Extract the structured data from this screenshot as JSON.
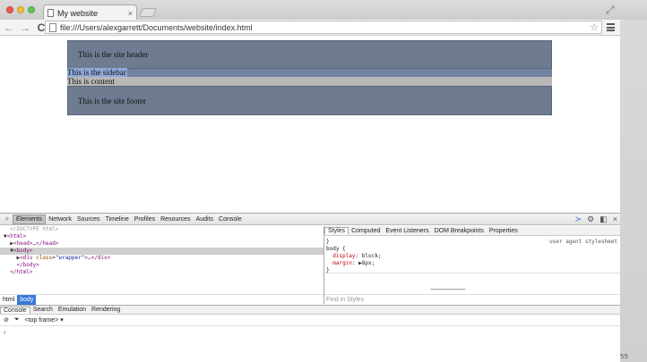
{
  "browser": {
    "tab_title": "My website",
    "tab_close": "×",
    "url": "file:///Users/alexgarrett/Documents/website/index.html",
    "back": "←",
    "forward": "→",
    "reload": "C",
    "star": "☆",
    "expand_icon": "⤢"
  },
  "page": {
    "header": "This is the site header",
    "sidebar": "This is the sidebar",
    "content": "This is content",
    "footer": "This is the site footer",
    "colors": {
      "header_bg": "#6e7b90",
      "content_bg": "#b8b8b8"
    }
  },
  "devtools": {
    "tabs": [
      "Elements",
      "Network",
      "Sources",
      "Timeline",
      "Profiles",
      "Resources",
      "Audits",
      "Console"
    ],
    "active_tab": "Elements",
    "dom": {
      "doctype": "<!DOCTYPE html>",
      "html_open": "<html>",
      "head": "<head>…</head>",
      "body_open": "<body>",
      "div_tag": "div",
      "div_attr": "class",
      "div_val": "\"wrapper\"",
      "div_rest": ">…</div>",
      "body_close": "</body>",
      "html_close": "</html>"
    },
    "breadcrumbs": [
      "html",
      "body"
    ],
    "styles_tabs": [
      "Styles",
      "Computed",
      "Event Listeners",
      "DOM Breakpoints",
      "Properties"
    ],
    "style_rule": {
      "brace_open": "}",
      "selector": "body {",
      "source": "user agent stylesheet",
      "p1_name": "display",
      "p1_value": "block;",
      "p2_name": "margin",
      "p2_value": "8px;",
      "brace_close": "}"
    },
    "find_placeholder": "Find in Styles",
    "dashes": "-----------------------------",
    "drawer_tabs": [
      "Console",
      "Search",
      "Emulation",
      "Rendering"
    ],
    "frame_select": "<top frame>",
    "prompt": "›",
    "corner_text": "55"
  }
}
